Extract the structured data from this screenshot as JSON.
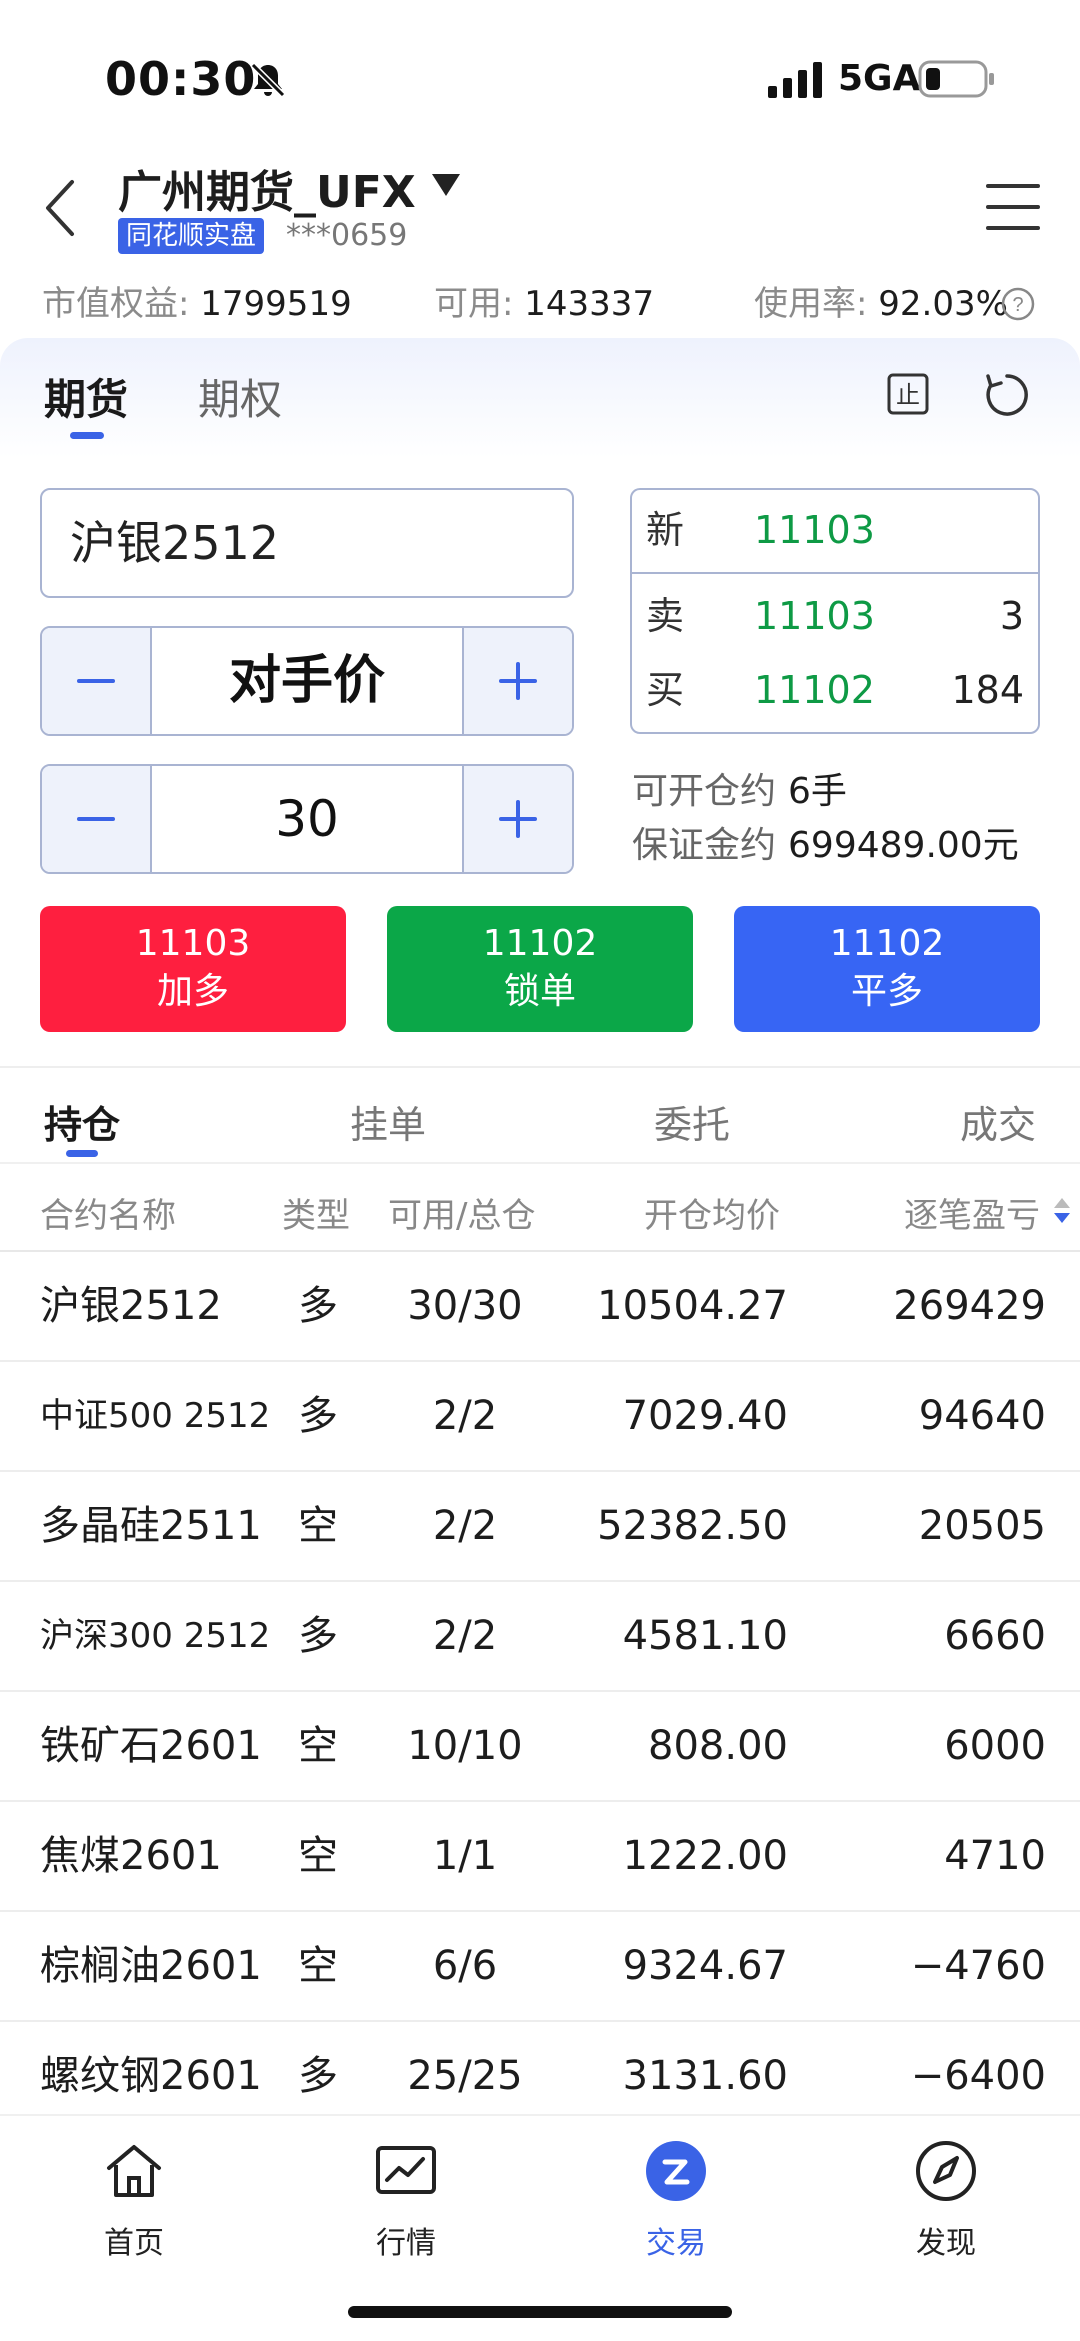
{
  "status_bar": {
    "time": "00:30",
    "network": "5GA"
  },
  "header": {
    "account_name": "广州期货_UFX",
    "badge": "同花顺实盘",
    "account_masked": "***0659"
  },
  "summary": {
    "equity_label": "市值权益:",
    "equity_value": "1799519",
    "available_label": "可用:",
    "available_value": "143337",
    "usage_label": "使用率:",
    "usage_value": "92.03%"
  },
  "product_tabs": {
    "futures": "期货",
    "options": "期权"
  },
  "order_form": {
    "contract": "沪银2512",
    "price_mode": "对手价",
    "quantity": "30"
  },
  "quote": {
    "last_label": "新",
    "last_price": "11103",
    "ask_label": "卖",
    "ask_price": "11103",
    "ask_volume": "3",
    "bid_label": "买",
    "bid_price": "11102",
    "bid_volume": "184"
  },
  "info": {
    "openable_label": "可开仓约",
    "openable_value": "6手",
    "margin_label": "保证金约",
    "margin_value": "699489.00元"
  },
  "actions": {
    "long": {
      "price": "11103",
      "label": "加多",
      "color": "#fe1f3f"
    },
    "lock": {
      "price": "11102",
      "label": "锁单",
      "color": "#0ba748"
    },
    "close": {
      "price": "11102",
      "label": "平多",
      "color": "#3765f4"
    }
  },
  "position_tabs": [
    "持仓",
    "挂单",
    "委托",
    "成交"
  ],
  "table": {
    "headers": [
      "合约名称",
      "类型",
      "可用/总仓",
      "开仓均价",
      "逐笔盈亏"
    ],
    "rows": [
      {
        "name": "沪银2512",
        "type": "多",
        "avail": "30/30",
        "avg": "10504.27",
        "pnl": "269429"
      },
      {
        "name": "中证500 2512",
        "type": "多",
        "avail": "2/2",
        "avg": "7029.40",
        "pnl": "94640"
      },
      {
        "name": "多晶硅2511",
        "type": "空",
        "avail": "2/2",
        "avg": "52382.50",
        "pnl": "20505"
      },
      {
        "name": "沪深300 2512",
        "type": "多",
        "avail": "2/2",
        "avg": "4581.10",
        "pnl": "6660"
      },
      {
        "name": "铁矿石2601",
        "type": "空",
        "avail": "10/10",
        "avg": "808.00",
        "pnl": "6000"
      },
      {
        "name": "焦煤2601",
        "type": "空",
        "avail": "1/1",
        "avg": "1222.00",
        "pnl": "4710"
      },
      {
        "name": "棕榈油2601",
        "type": "空",
        "avail": "6/6",
        "avg": "9324.67",
        "pnl": "−4760"
      },
      {
        "name": "螺纹钢2601",
        "type": "多",
        "avail": "25/25",
        "avg": "3131.60",
        "pnl": "−6400"
      }
    ]
  },
  "bottom_nav": [
    {
      "label": "首页",
      "icon": "home-icon"
    },
    {
      "label": "行情",
      "icon": "chart-icon"
    },
    {
      "label": "交易",
      "icon": "trade-icon"
    },
    {
      "label": "发现",
      "icon": "compass-icon"
    }
  ],
  "colors": {
    "accent": "#3a63e6",
    "up": "#e8283c",
    "down": "#0e9a45"
  }
}
